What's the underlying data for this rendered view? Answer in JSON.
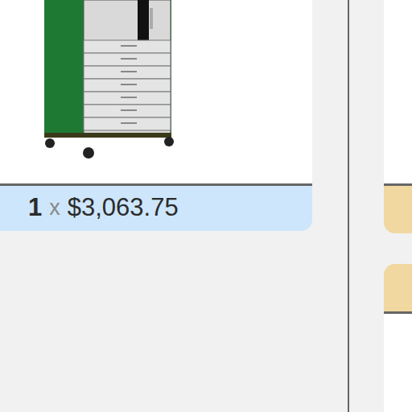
{
  "cart_items": [
    {
      "quantity": "1",
      "separator": "x",
      "price": "$3,063.75"
    }
  ]
}
